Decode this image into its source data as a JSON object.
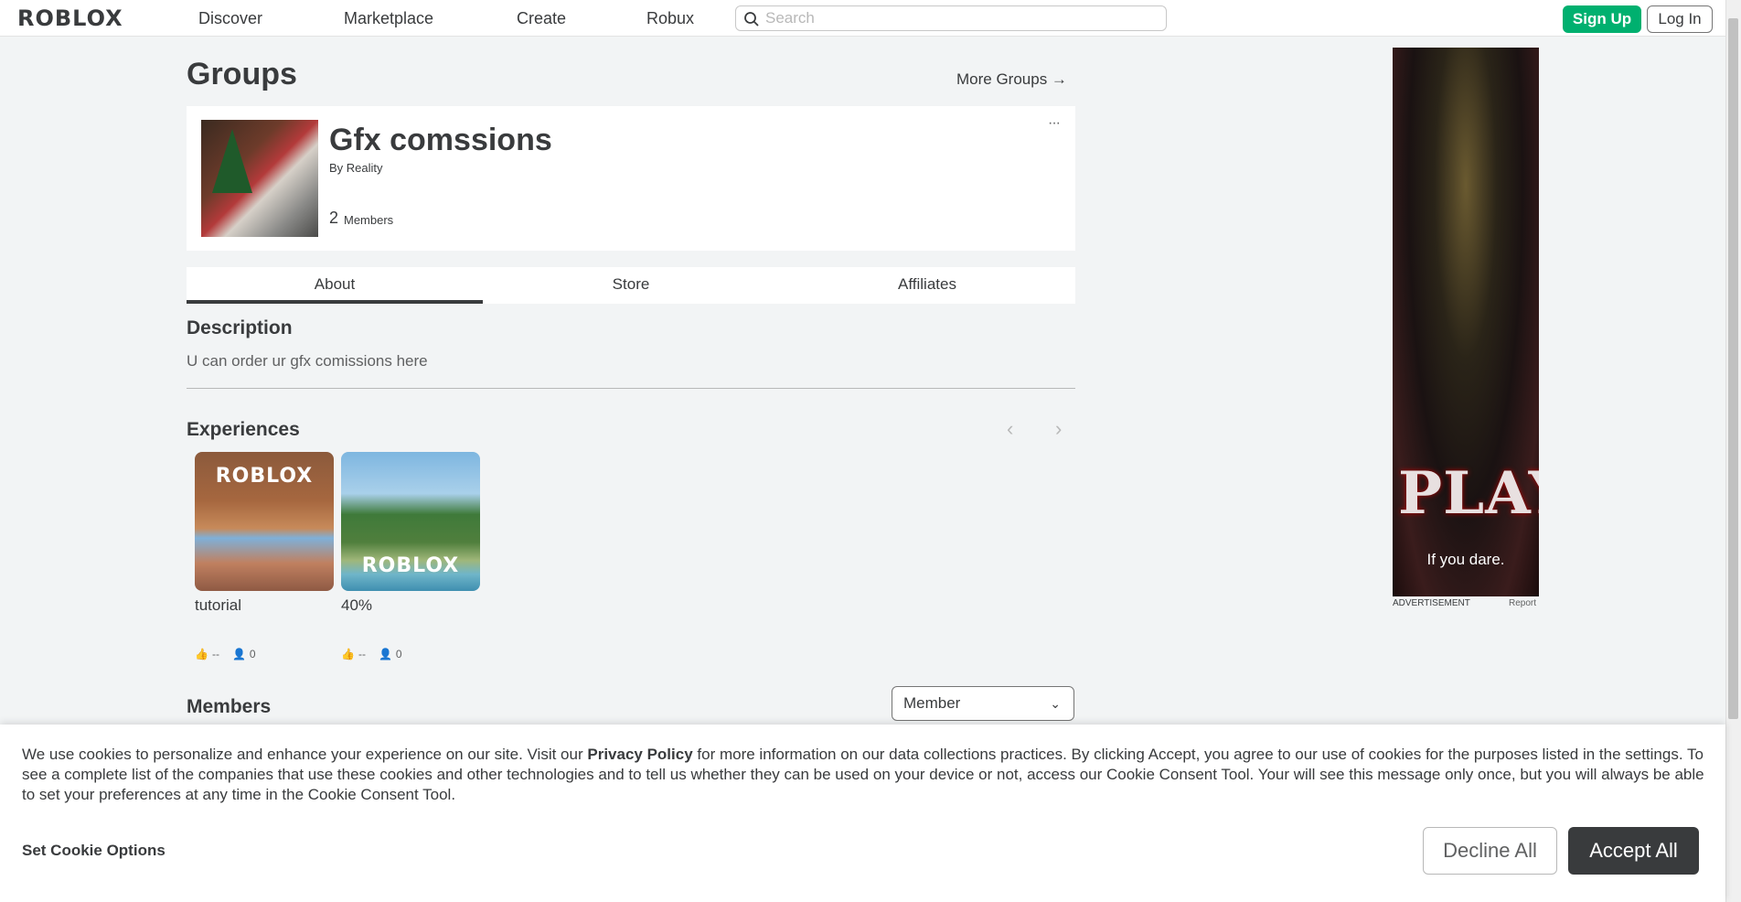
{
  "header": {
    "logo": "ROBLOX",
    "nav": [
      "Discover",
      "Marketplace",
      "Create",
      "Robux"
    ],
    "search_placeholder": "Search",
    "signup": "Sign Up",
    "login": "Log In"
  },
  "page": {
    "title": "Groups",
    "more_groups": "More Groups →"
  },
  "group": {
    "name": "Gfx comssions",
    "by_prefix": "By",
    "owner": "Reality",
    "member_count": "2",
    "members_label": "Members",
    "more_menu": "···"
  },
  "tabs": [
    "About",
    "Store",
    "Affiliates"
  ],
  "about": {
    "description_title": "Description",
    "description": "U can order ur gfx comissions here",
    "experiences_title": "Experiences",
    "experiences": [
      {
        "name": "tutorial",
        "likes": "--",
        "players": "0",
        "logo": "ROBLOX"
      },
      {
        "name": "40%",
        "likes": "--",
        "players": "0",
        "logo": "ROBLOX"
      }
    ],
    "members_title": "Members",
    "members_filter": "Member"
  },
  "ad": {
    "headline": "PLAY",
    "tagline": "If you dare.",
    "label": "ADVERTISEMENT",
    "report": "Report"
  },
  "cookie": {
    "text_before": "We use cookies to personalize and enhance your experience on our site. Visit our ",
    "link": "Privacy Policy",
    "text_after": " for more information on our data collections practices. By clicking Accept, you agree to our use of cookies for the purposes listed in the settings. To see a complete list of the companies that use these cookies and other technologies and to tell us whether they can be used on your device or not, access our Cookie Consent Tool. Your will see this message only once, but you will always be able to set your preferences at any time in the Cookie Consent Tool.",
    "options": "Set Cookie Options",
    "decline": "Decline All",
    "accept": "Accept All"
  },
  "colors": {
    "brand_green": "#00b06f",
    "text_dark": "#393b3d",
    "background": "#f2f4f5"
  }
}
